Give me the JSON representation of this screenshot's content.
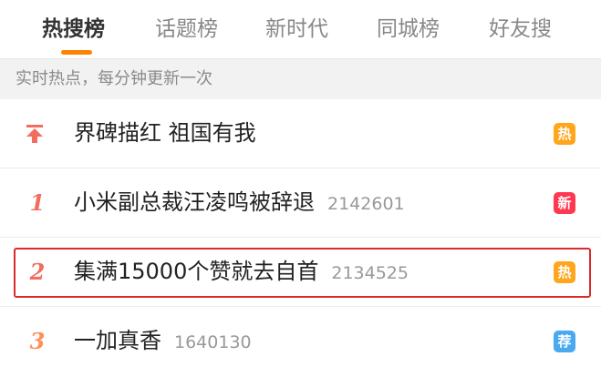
{
  "tabs": [
    {
      "label": "热搜榜",
      "active": true
    },
    {
      "label": "话题榜",
      "active": false
    },
    {
      "label": "新时代",
      "active": false
    },
    {
      "label": "同城榜",
      "active": false
    },
    {
      "label": "好友搜",
      "active": false
    }
  ],
  "subheader": {
    "text": "实时热点，每分钟更新一次"
  },
  "colors": {
    "accent": "#ff8200",
    "rank_top": "#f26d5f",
    "rank_1": "#f26d5f",
    "rank_2": "#f26d5f",
    "rank_3": "#ff8f59",
    "badge_hot": "#ffa61c",
    "badge_new": "#ff3852",
    "badge_rec": "#4aa9f0",
    "highlight_border": "#d92b2b"
  },
  "rows": [
    {
      "rank": "",
      "rank_icon": "pin-top-icon",
      "title": "界碑描红 祖国有我",
      "count": "",
      "badge": "热",
      "badge_type": "hot"
    },
    {
      "rank": "1",
      "title": "小米副总裁汪凌鸣被辞退",
      "count": "2142601",
      "badge": "新",
      "badge_type": "new"
    },
    {
      "rank": "2",
      "title": "集满15000个赞就去自首",
      "count": "2134525",
      "badge": "热",
      "badge_type": "hot",
      "highlighted": true
    },
    {
      "rank": "3",
      "title": "一加真香",
      "count": "1640130",
      "badge": "荐",
      "badge_type": "recommend"
    }
  ]
}
